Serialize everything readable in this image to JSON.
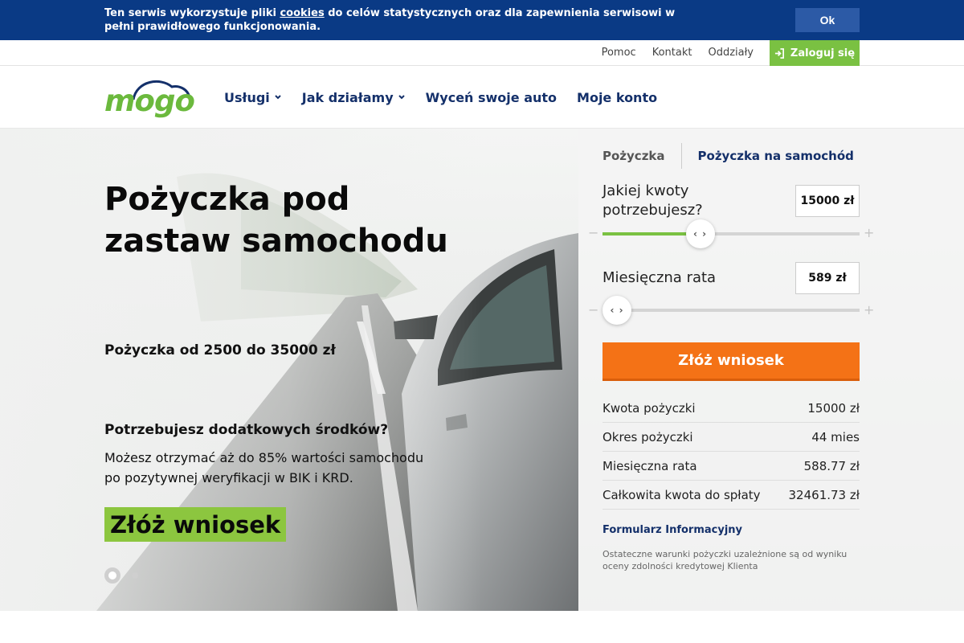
{
  "cookie": {
    "text_before": "Ten serwis wykorzystuje pliki ",
    "link": "cookies",
    "text_after": " do celów statystycznych oraz dla zapewnienia serwisowi w pełni prawidłowego funkcjonowania.",
    "ok": "Ok"
  },
  "topbar": {
    "links": [
      "Pomoc",
      "Kontakt",
      "Oddziały"
    ],
    "login": "Zaloguj się"
  },
  "nav": {
    "logo": "mogo",
    "items": [
      "Usługi",
      "Jak działamy",
      "Wyceń swoje auto",
      "Moje konto"
    ]
  },
  "hero": {
    "title": "Pożyczka pod zastaw samochodu",
    "range": "Pożyczka od 2500 do 35000 zł",
    "question": "Potrzebujesz dodatkowych środków?",
    "description": "Możesz otrzymać aż do 85% wartości samochodu po pozytywnej weryfikacji w BIK i KRD.",
    "cta": "Złóż wniosek"
  },
  "calculator": {
    "tabs": [
      "Pożyczka",
      "Pożyczka na samochód"
    ],
    "amount_label": "Jakiej kwoty potrzebujesz?",
    "amount_value": "15000 zł",
    "amount_fraction": 0.38,
    "rate_label": "Miesięczna rata",
    "rate_value": "589 zł",
    "rate_fraction": 0.0,
    "submit": "Złóż wniosek",
    "summary": [
      {
        "label": "Kwota pożyczki",
        "value": "15000 zł"
      },
      {
        "label": "Okres pożyczki",
        "value": "44 mies"
      },
      {
        "label": "Miesięczna rata",
        "value": "588.77 zł"
      },
      {
        "label": "Całkowita kwota do spłaty",
        "value": "32461.73 zł"
      }
    ],
    "form_link": "Formularz Informacyjny",
    "disclaimer": "Ostateczne warunki pożyczki uzależnione są od wyniku oceny zdolności kredytowej Klienta"
  },
  "colors": {
    "cookie_bg": "#0a3a85",
    "brand_green": "#7ac142",
    "nav_text": "#14306a",
    "cta_orange": "#f47216"
  }
}
